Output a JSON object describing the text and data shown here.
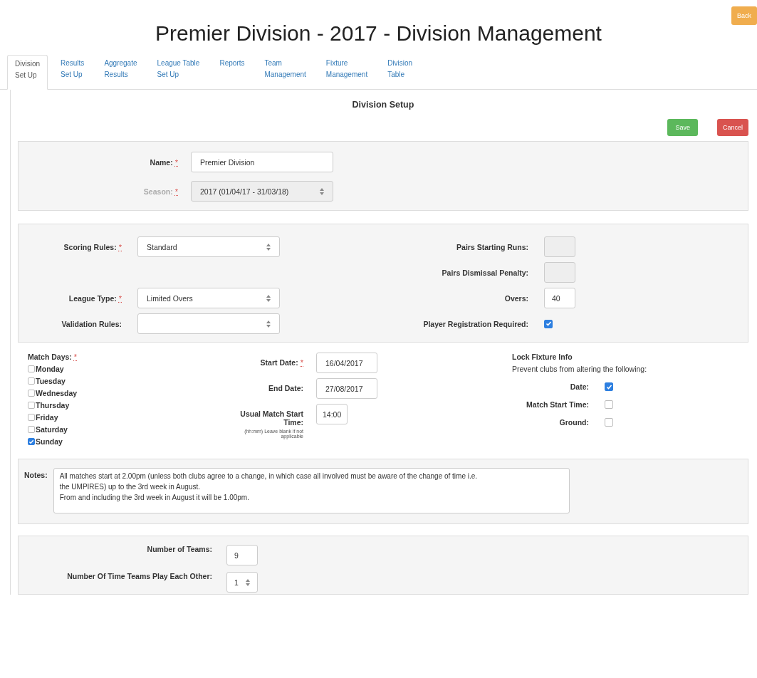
{
  "title": "Premier Division - 2017 - Division Management",
  "back_button": "Back",
  "tabs": [
    {
      "label": "Division\nSet Up",
      "selected": true
    },
    {
      "label": "Results\nSet Up",
      "selected": false
    },
    {
      "label": "Aggregate\nResults",
      "selected": false
    },
    {
      "label": "League Table\nSet Up",
      "selected": false
    },
    {
      "label": "Reports",
      "selected": false
    },
    {
      "label": "Team\nManagement",
      "selected": false
    },
    {
      "label": "Fixture\nManagement",
      "selected": false
    },
    {
      "label": "Division\nTable",
      "selected": false
    }
  ],
  "section_title": "Division Setup",
  "buttons": [
    {
      "label": "Save",
      "kind": "save"
    },
    {
      "label": "Cancel",
      "kind": "cancel"
    }
  ],
  "required_mark": "*",
  "name_panel": [
    {
      "label": "Name:",
      "required": true,
      "kind": "input",
      "value": "Premier Division",
      "disabled": false
    },
    {
      "label": "Season:",
      "required": true,
      "kind": "select",
      "value": "2017 (01/04/17 - 31/03/18)",
      "disabled": true
    }
  ],
  "rules_left": [
    {
      "label": "Scoring Rules:",
      "required": true,
      "kind": "select",
      "value": "Standard"
    },
    {
      "kind": "blank"
    },
    {
      "label": "League Type:",
      "required": true,
      "kind": "select",
      "value": "Limited Overs"
    },
    {
      "label": "Validation Rules:",
      "required": false,
      "kind": "select"
    }
  ],
  "rules_right": [
    {
      "label": "Pairs Starting Runs:",
      "kind": "input",
      "disabled": true
    },
    {
      "label": "Pairs Dismissal Penalty:",
      "kind": "input",
      "disabled": true
    },
    {
      "label": "Overs:",
      "kind": "input",
      "value": "40",
      "disabled": false
    },
    {
      "label": "Player Registration Required:",
      "kind": "checkbox",
      "checked": true
    }
  ],
  "match_days": {
    "label": "Match Days:",
    "required": true,
    "days": [
      {
        "label": "Monday",
        "checked": false
      },
      {
        "label": "Tuesday",
        "checked": false
      },
      {
        "label": "Wednesday",
        "checked": false
      },
      {
        "label": "Thursday",
        "checked": false
      },
      {
        "label": "Friday",
        "checked": false
      },
      {
        "label": "Saturday",
        "checked": false
      },
      {
        "label": "Sunday",
        "checked": true
      }
    ]
  },
  "dates": [
    {
      "label": "Start Date:",
      "required": true,
      "value": "16/04/2017"
    },
    {
      "label": "End Date:",
      "required": false,
      "value": "27/08/2017"
    },
    {
      "label": "Usual Match Start Time:",
      "required": false,
      "value": "14:00",
      "hint": "(hh:mm) Leave blank if not applicable"
    }
  ],
  "lock_fixture": {
    "title": "Lock Fixture Info",
    "subtitle": "Prevent clubs from altering the following:",
    "items": [
      {
        "label": "Date:",
        "checked": true
      },
      {
        "label": "Match Start Time:",
        "checked": false
      },
      {
        "label": "Ground:",
        "checked": false
      }
    ]
  },
  "notes": {
    "label": "Notes:",
    "value": "All matches start at 2.00pm (unless both clubs agree to a change, in which case all involved must be aware of the change of time i.e.\nthe UMPIRES) up to the 3rd week in August.\nFrom and including the 3rd week in August it will be 1.00pm."
  },
  "teams": [
    {
      "label": "Number of Teams:",
      "kind": "input",
      "value": "9"
    },
    {
      "label": "Number Of Time Teams Play Each Other:",
      "kind": "select",
      "value": "1"
    }
  ]
}
